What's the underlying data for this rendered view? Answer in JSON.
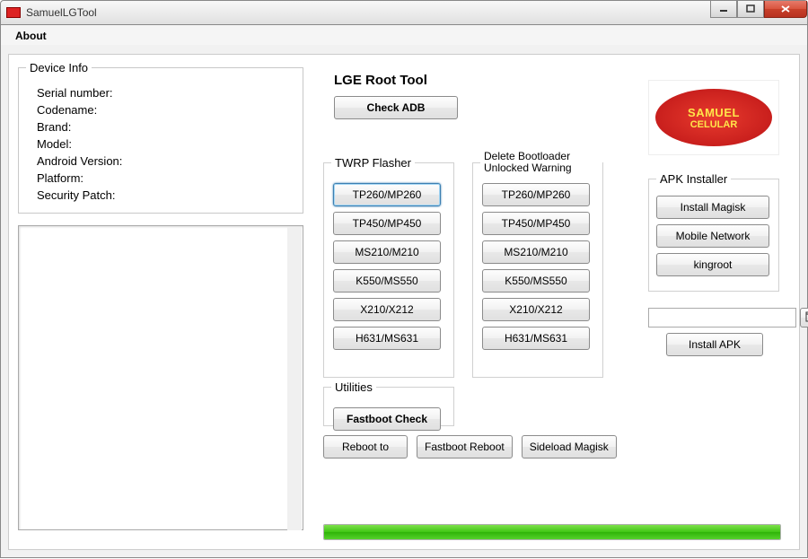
{
  "window": {
    "title": "SamuelLGTool"
  },
  "menubar": {
    "about": "About"
  },
  "device_info": {
    "legend": "Device Info",
    "fields": {
      "serial": "Serial number:",
      "codename": "Codename:",
      "brand": "Brand:",
      "model": "Model:",
      "android": "Android Version:",
      "platform": "Platform:",
      "security": "Security Patch:"
    }
  },
  "tool": {
    "title": "LGE Root Tool",
    "check_adb": "Check ADB"
  },
  "twrp": {
    "legend": "TWRP Flasher",
    "buttons": [
      "TP260/MP260",
      "TP450/MP450",
      "MS210/M210",
      "K550/MS550",
      "X210/X212",
      "H631/MS631"
    ]
  },
  "delbl": {
    "legend": "Delete Bootloader Unlocked Warning",
    "buttons": [
      "TP260/MP260",
      "TP450/MP450",
      "MS210/M210",
      "K550/MS550",
      "X210/X212",
      "H631/MS631"
    ]
  },
  "utilities": {
    "legend": "Utilities",
    "fastboot_check": "Fastboot Check",
    "reboot_to": "Reboot to",
    "fastboot_reboot": "Fastboot Reboot",
    "sideload_magisk": "Sideload Magisk"
  },
  "apk": {
    "legend": "APK Installer",
    "install_magisk": "Install Magisk",
    "mobile_network": "Mobile Network",
    "kingroot": "kingroot",
    "path_value": "",
    "install_apk": "Install APK"
  },
  "logo": {
    "line1": "SAMUEL",
    "line2": "CELULAR"
  },
  "progress": {
    "percent": 100
  }
}
